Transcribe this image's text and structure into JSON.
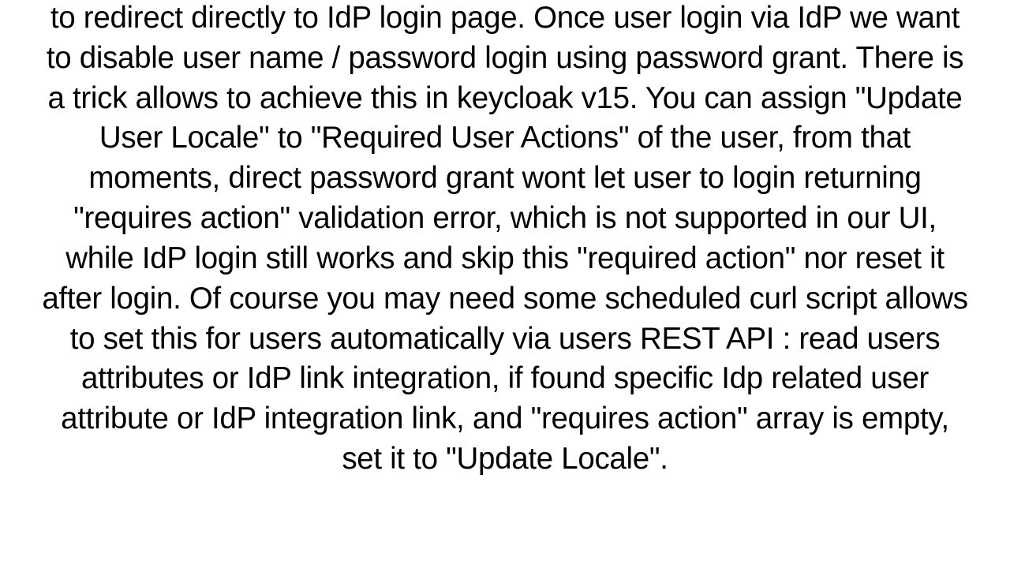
{
  "document": {
    "paragraph": "to redirect directly to IdP login page. Once user login via IdP we want to disable user name / password login using password grant. There is a trick allows to achieve this in keycloak v15. You can assign \"Update User Locale\" to \"Required User Actions\" of the user, from that moments, direct password grant wont let user to login returning \"requires action\" validation error, which is not supported in our UI, while IdP login still works and skip this \"required action\" nor reset it after login. Of course you may need some scheduled curl script allows to set this for users automatically via users REST API : read users attributes or IdP link integration, if found specific Idp related user attribute or IdP integration link, and \"requires action\" array is empty, set it to \"Update Locale\"."
  }
}
